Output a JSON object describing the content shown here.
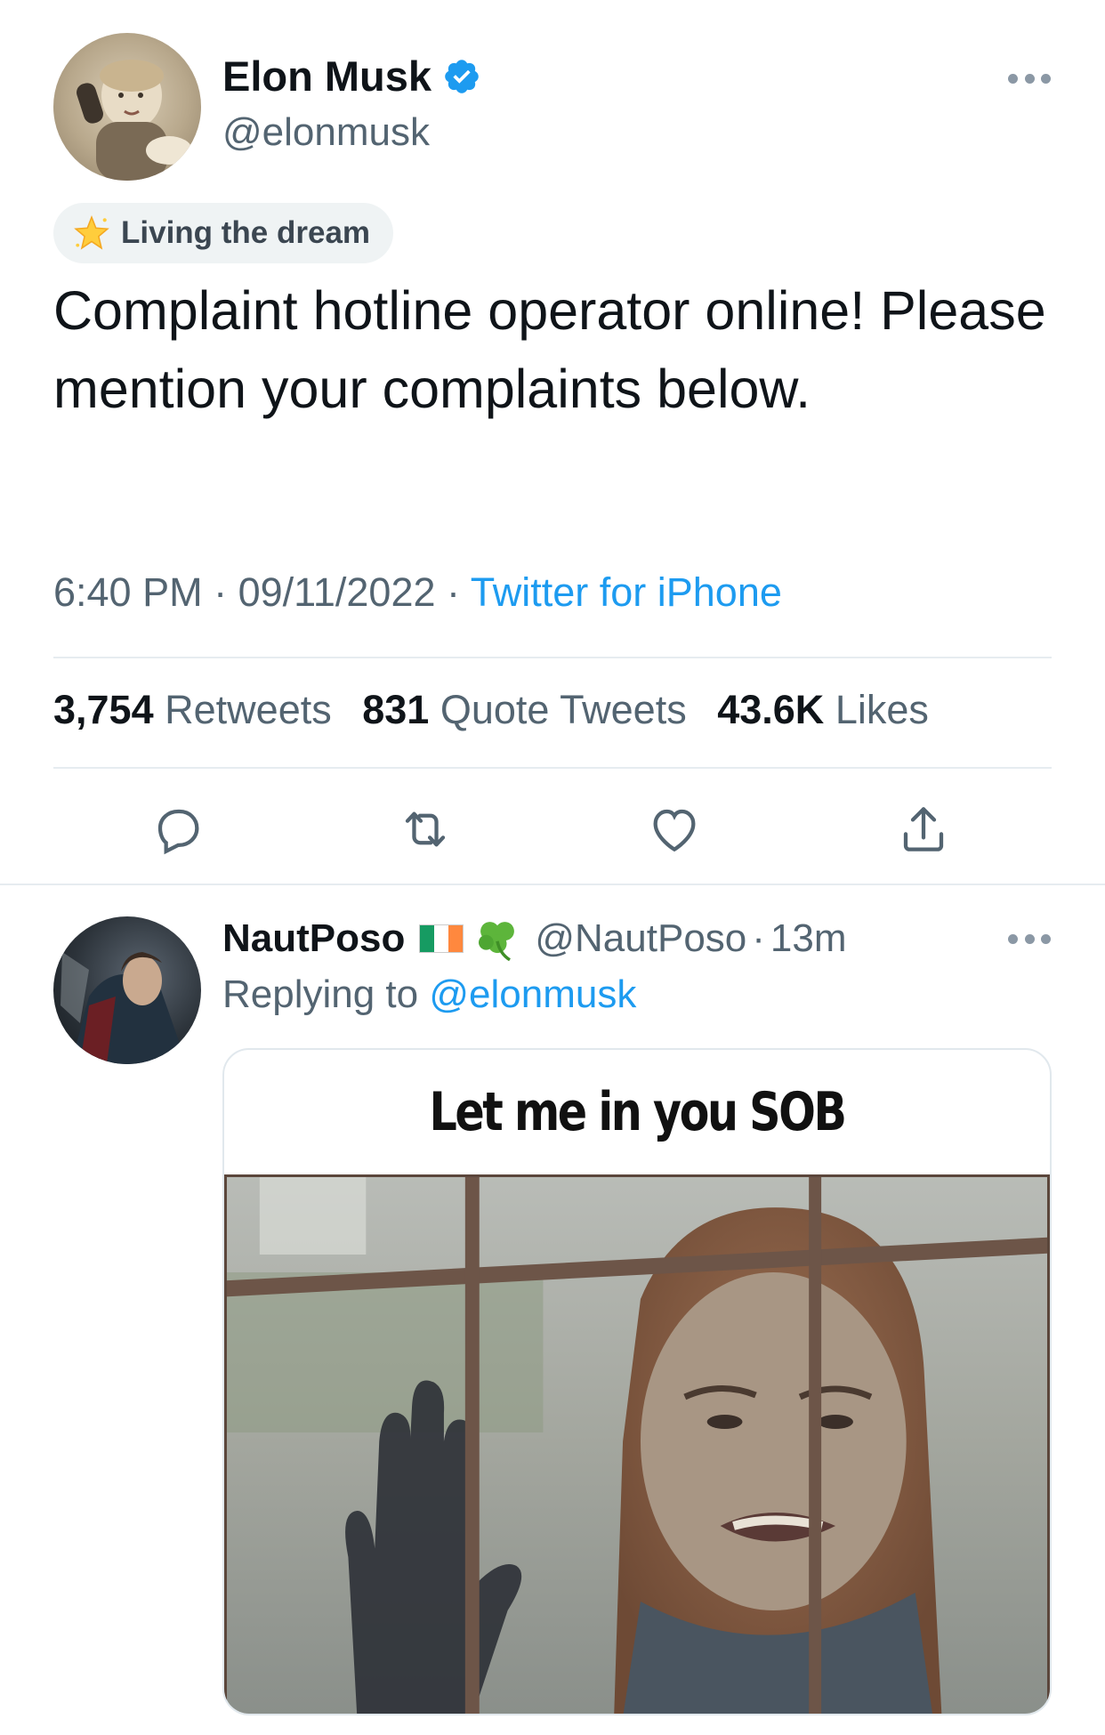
{
  "main_tweet": {
    "author": {
      "name": "Elon Musk",
      "handle": "@elonmusk",
      "verified": true,
      "avatar_icon": "child-with-telephone-photo"
    },
    "label": {
      "icon": "star-sparkle-icon",
      "text": "Living the dream"
    },
    "text": "Complaint hotline operator online! Please mention your complaints below.",
    "meta": {
      "time": "6:40 PM",
      "date": "09/11/2022",
      "separator": "·",
      "source": "Twitter for iPhone"
    },
    "stats": {
      "retweets_count": "3,754",
      "retweets_label": "Retweets",
      "quotes_count": "831",
      "quotes_label": "Quote Tweets",
      "likes_count": "43.6K",
      "likes_label": "Likes"
    },
    "actions": [
      "reply-icon",
      "retweet-icon",
      "like-icon",
      "share-icon"
    ]
  },
  "reply": {
    "author": {
      "name": "NautPoso",
      "flag": "ireland-flag-icon",
      "emoji": "shamrock-icon",
      "handle": "@NautPoso",
      "time": "13m",
      "avatar_icon": "caped-figure-photo"
    },
    "replying_prefix": "Replying to",
    "replying_to": "@elonmusk",
    "media": {
      "caption": "Let me in you SOB"
    }
  },
  "colors": {
    "accent": "#1d9bf0",
    "text_primary": "#0f1419",
    "text_secondary": "#536471",
    "divider": "#e6ecf0",
    "flag_green": "#169b62",
    "flag_white": "#ffffff",
    "flag_orange": "#ff883e"
  }
}
